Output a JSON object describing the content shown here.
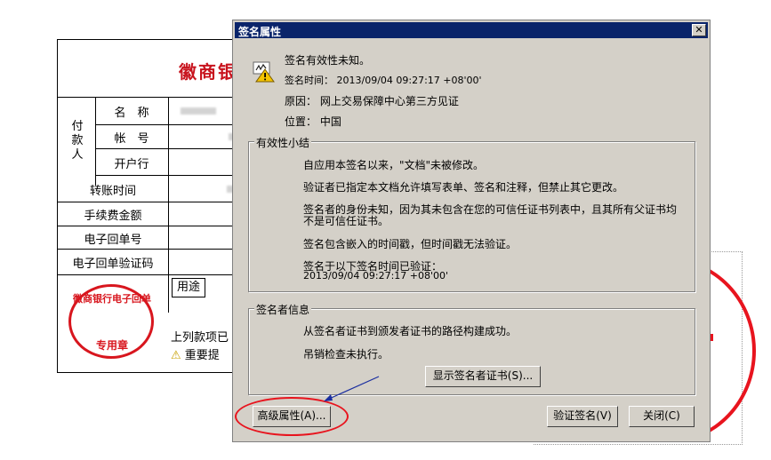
{
  "receipt": {
    "bank_title": "徽商银",
    "payer_group": "付款人",
    "rows": [
      "名　称",
      "帐　号",
      "开户行",
      "转账时间",
      "手续费金额",
      "电子回单号",
      "电子回单验证码"
    ],
    "stamp_top": "徽商银行电子回单",
    "stamp_bottom": "专用章",
    "usage_label": "用途",
    "note1": "上列款项已",
    "note2": "重要提"
  },
  "dialog": {
    "title": "签名属性",
    "close_glyph": "✕",
    "status": "签名有效性未知。",
    "time": "签名时间： 2013/09/04 09:27:17 +08'00'",
    "reason": "原因： 网上交易保障中心第三方见证",
    "location": "位置： 中国",
    "validity": {
      "label": "有效性小结",
      "line1": "自应用本签名以来，\"文档\"未被修改。",
      "line2": "验证者已指定本文档允许填写表单、签名和注释，但禁止其它更改。",
      "line3a": "签名者的身份未知，因为其未包含在您的可信任证书列表中，且其所有父证书均",
      "line3b": "不是可信任证书。",
      "line4": "签名包含嵌入的时间戳，但时间戳无法验证。",
      "line5a": "签名于以下签名时间已验证：",
      "line5b": "2013/09/04 09:27:17 +08'00'"
    },
    "signer": {
      "label": "签名者信息",
      "line1": "从签名者证书到颁发者证书的路径构建成功。",
      "line2": "吊销检查未执行。",
      "show_cert_button": "显示签名者证书(S)..."
    },
    "buttons": {
      "advanced": "高级属性(A)...",
      "verify": "验证签名(V)",
      "close": "关闭(C)"
    }
  },
  "colors": {
    "titlebar": "#0a246a",
    "dialog_bg": "#d4d0c8",
    "stamp_red": "#d8161e",
    "annotation_red": "#e8141e",
    "arrow_blue": "#1a2ea0"
  }
}
